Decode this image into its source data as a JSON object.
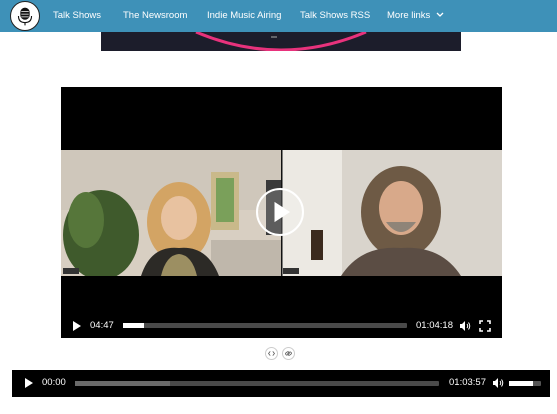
{
  "nav": {
    "items": [
      {
        "label": "Talk Shows"
      },
      {
        "label": "The Newsroom"
      },
      {
        "label": "Indie Music Airing"
      },
      {
        "label": "Talk Shows RSS"
      },
      {
        "label": "More links"
      }
    ]
  },
  "video": {
    "current_time": "04:47",
    "duration": "01:04:18",
    "progress_fraction": 0.075
  },
  "audio": {
    "current_time": "00:00",
    "duration": "01:03:57",
    "buffered_fraction": 0.26,
    "volume_fraction": 0.75
  },
  "icons": {
    "embed": "code-icon",
    "link": "link-icon"
  },
  "colors": {
    "nav_background": "#3e91b8",
    "player_background": "#000000",
    "banner_ring": "#e8327c"
  }
}
